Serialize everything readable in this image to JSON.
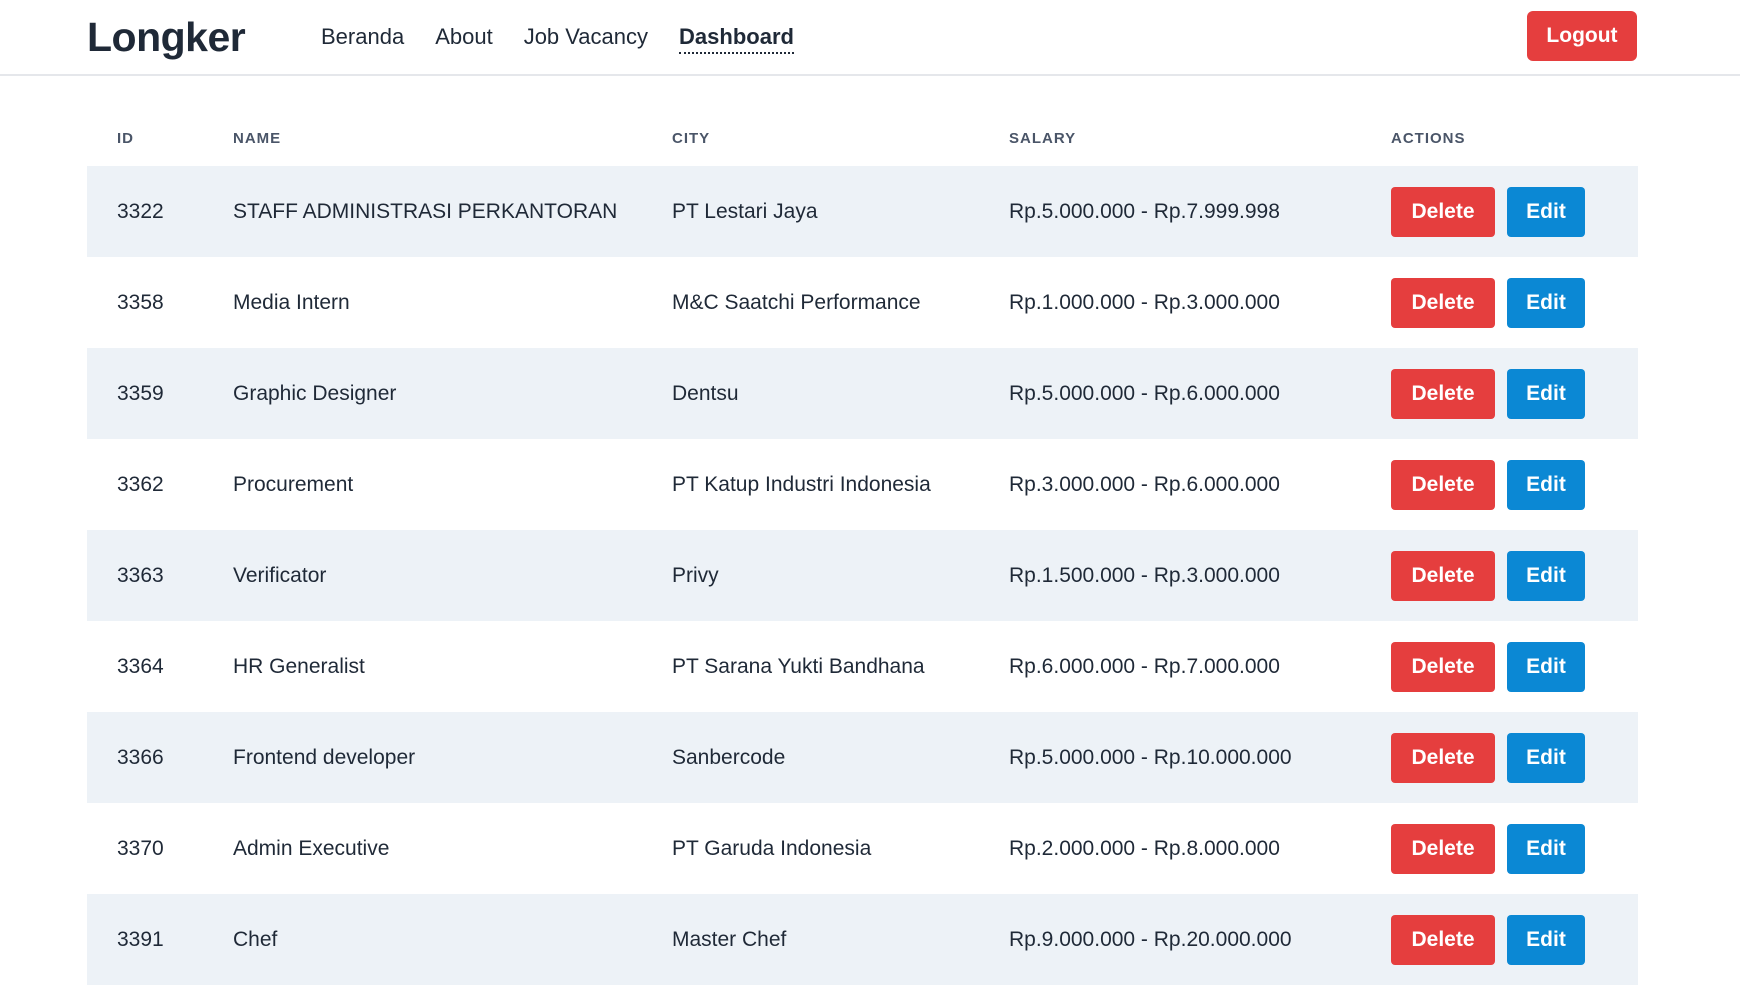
{
  "navbar": {
    "brand": "Longker",
    "links": [
      {
        "label": "Beranda",
        "active": false
      },
      {
        "label": "About",
        "active": false
      },
      {
        "label": "Job Vacancy",
        "active": false
      },
      {
        "label": "Dashboard",
        "active": true
      }
    ],
    "logout_label": "Logout"
  },
  "table": {
    "headers": {
      "id": "ID",
      "name": "NAME",
      "city": "CITY",
      "salary": "SALARY",
      "actions": "ACTIONS"
    },
    "delete_label": "Delete",
    "edit_label": "Edit",
    "rows": [
      {
        "id": "3322",
        "name": "STAFF ADMINISTRASI PERKANTORAN",
        "city": "PT Lestari Jaya",
        "salary": "Rp.5.000.000 - Rp.7.999.998"
      },
      {
        "id": "3358",
        "name": "Media Intern",
        "city": "M&C Saatchi Performance",
        "salary": "Rp.1.000.000 - Rp.3.000.000"
      },
      {
        "id": "3359",
        "name": "Graphic Designer",
        "city": "Dentsu",
        "salary": "Rp.5.000.000 - Rp.6.000.000"
      },
      {
        "id": "3362",
        "name": "Procurement",
        "city": "PT Katup Industri Indonesia",
        "salary": "Rp.3.000.000 - Rp.6.000.000"
      },
      {
        "id": "3363",
        "name": "Verificator",
        "city": "Privy",
        "salary": "Rp.1.500.000 - Rp.3.000.000"
      },
      {
        "id": "3364",
        "name": "HR Generalist",
        "city": "PT Sarana Yukti Bandhana",
        "salary": "Rp.6.000.000 - Rp.7.000.000"
      },
      {
        "id": "3366",
        "name": "Frontend developer",
        "city": "Sanbercode",
        "salary": "Rp.5.000.000 - Rp.10.000.000"
      },
      {
        "id": "3370",
        "name": "Admin Executive",
        "city": "PT Garuda Indonesia",
        "salary": "Rp.2.000.000 - Rp.8.000.000"
      },
      {
        "id": "3391",
        "name": "Chef",
        "city": "Master Chef",
        "salary": "Rp.9.000.000 - Rp.20.000.000"
      }
    ]
  },
  "colors": {
    "delete": "#e53e3e",
    "edit": "#0b88d4",
    "row_stripe": "#edf2f7"
  }
}
